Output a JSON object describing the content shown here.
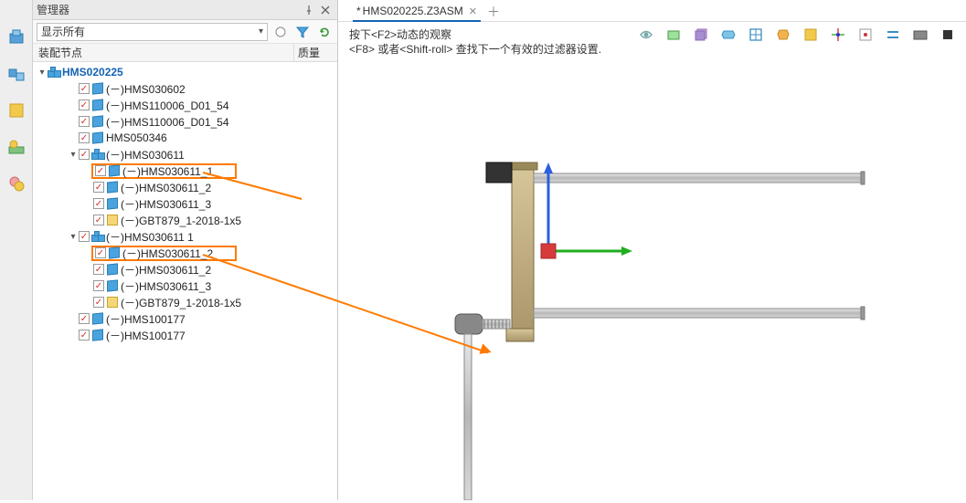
{
  "manager": {
    "title": "管理器",
    "filter_label": "显示所有",
    "columns": {
      "name": "装配节点",
      "qty": "质量"
    },
    "tree": {
      "root": "HMS020225",
      "nodes": [
        {
          "indent": 1,
          "twisty": "",
          "label": "(－)HMS030602"
        },
        {
          "indent": 1,
          "twisty": "",
          "label": "(－)HMS110006_D01_54"
        },
        {
          "indent": 1,
          "twisty": "",
          "label": "(－)HMS110006_D01_54"
        },
        {
          "indent": 1,
          "twisty": "",
          "label": "HMS050346"
        },
        {
          "indent": 1,
          "twisty": "open",
          "icon": "asm",
          "label": "(－)HMS030611"
        },
        {
          "indent": 2,
          "twisty": "",
          "highlight": true,
          "label": "(－)HMS030611_1"
        },
        {
          "indent": 2,
          "twisty": "",
          "label": "(－)HMS030611_2"
        },
        {
          "indent": 2,
          "twisty": "",
          "label": "(－)HMS030611_3"
        },
        {
          "indent": 2,
          "twisty": "",
          "icon": "file",
          "label": "(－)GBT879_1-2018-1x5"
        },
        {
          "indent": 1,
          "twisty": "open",
          "icon": "asm",
          "label": "(－)HMS030611 1"
        },
        {
          "indent": 2,
          "twisty": "",
          "highlight": true,
          "label": "(－)HMS030611_2"
        },
        {
          "indent": 2,
          "twisty": "",
          "label": "(－)HMS030611_2"
        },
        {
          "indent": 2,
          "twisty": "",
          "label": "(－)HMS030611_3"
        },
        {
          "indent": 2,
          "twisty": "",
          "icon": "file",
          "label": "(－)GBT879_1-2018-1x5"
        },
        {
          "indent": 1,
          "twisty": "",
          "label": "(－)HMS100177"
        },
        {
          "indent": 1,
          "twisty": "",
          "label": "(－)HMS100177"
        }
      ]
    }
  },
  "tabs": {
    "active": "HMS020225.Z3ASM",
    "dirty_marker": "*"
  },
  "hints": {
    "line1": "按下<F2>动态的观察",
    "line2": "<F8> 或者<Shift-roll> 查找下一个有效的过滤器设置."
  },
  "icons": {
    "funnel": "funnel-icon",
    "refresh": "refresh-icon",
    "pin": "pin-icon",
    "close": "close-icon",
    "expand": "expand-icon",
    "add_tab": "add-icon"
  },
  "colors": {
    "highlight": "#ff7a00",
    "link": "#1463b3",
    "part": "#4aa3df"
  }
}
